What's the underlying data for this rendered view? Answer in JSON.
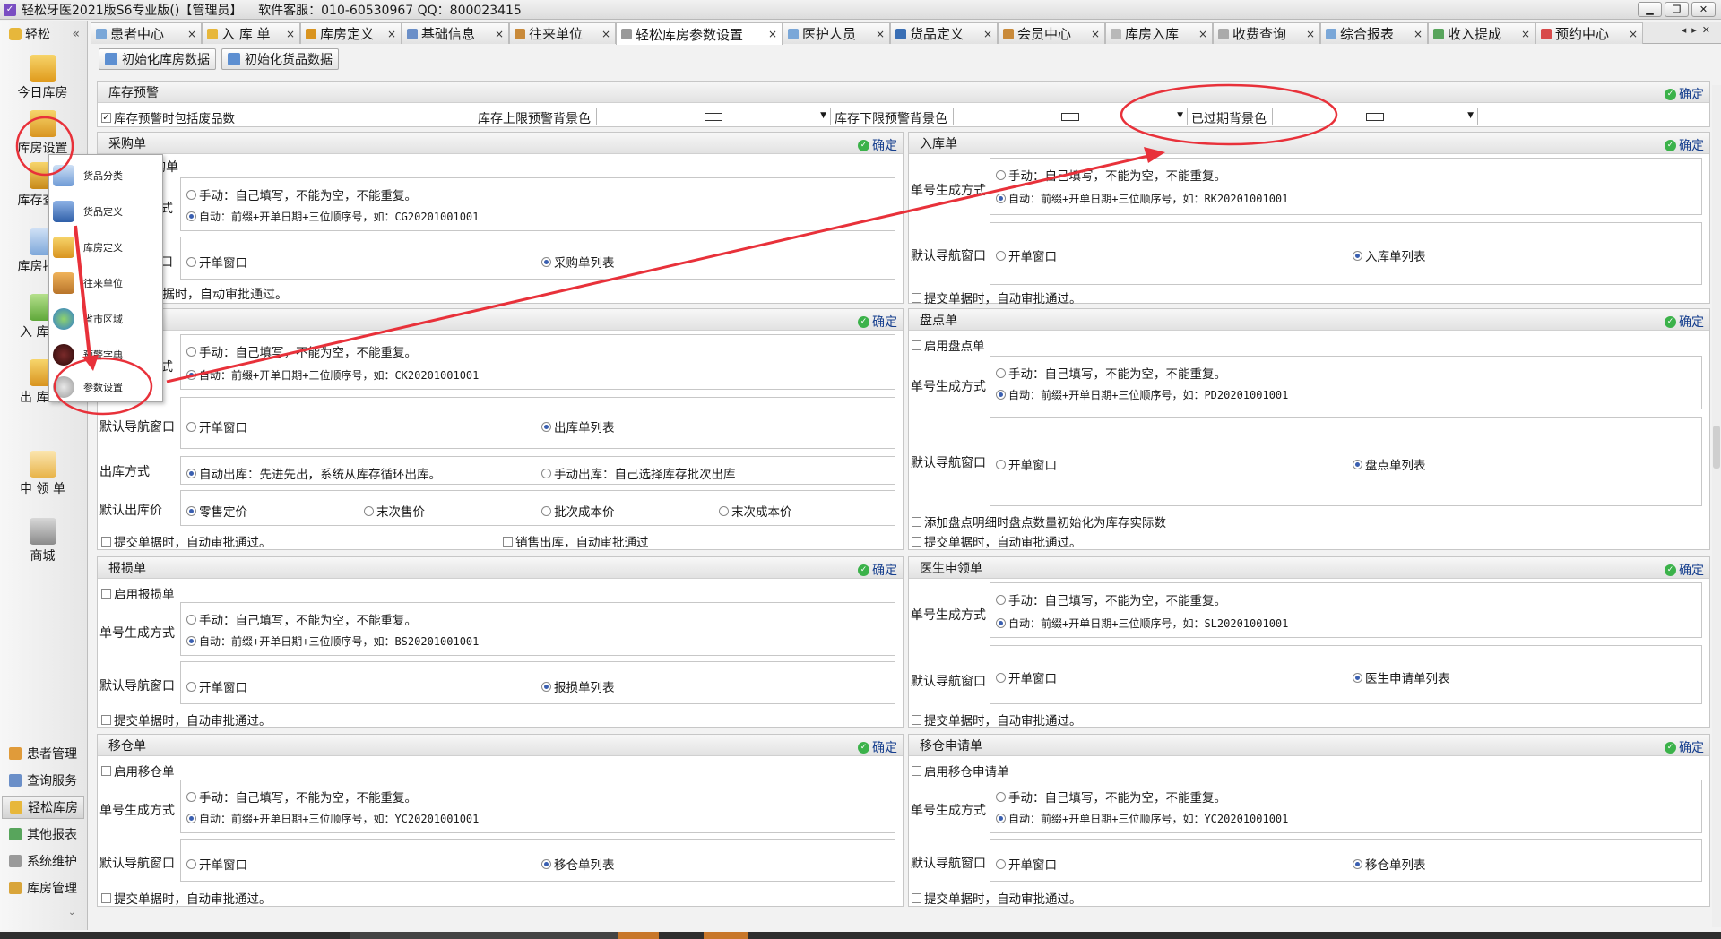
{
  "app": {
    "title": "轻松牙医2021版S6专业版()【管理员】    软件客服：010-60530967 QQ：800023415"
  },
  "nav": {
    "header": "轻松",
    "collapse": "«",
    "items": [
      "今日库房",
      "库房设置",
      "库存查询",
      "库房报表",
      "入 库 单",
      "出 库 单",
      "申 领 单",
      "商城"
    ],
    "bottom": [
      "患者管理",
      "查询服务",
      "轻松库房",
      "其他报表",
      "系统维护",
      "库房管理"
    ]
  },
  "tabs": [
    "患者中心",
    "入 库 单",
    "库房定义",
    "基础信息",
    "往来单位",
    "轻松库房参数设置",
    "医护人员",
    "货品定义",
    "会员中心",
    "库房入库",
    "收费查询",
    "综合报表",
    "收入提成",
    "预约中心"
  ],
  "toolbar": {
    "init_warehouse": "初始化库房数据",
    "init_goods": "初始化货品数据"
  },
  "common": {
    "ok": "确定",
    "manual": "手动：自己填写，不能为空，不能重复。",
    "number_mode": "单号生成方式",
    "nav_window": "默认导航窗口",
    "open_window": "开单窗口",
    "auto_approve": "提交单据时，自动审批通过。"
  },
  "warning": {
    "title": "库存预警",
    "include_waste": "库存预警时包括废品数",
    "upper_color": "库存上限预警背景色",
    "lower_color": "库存下限预警背景色",
    "expired_color": "已过期背景色"
  },
  "purchase": {
    "title": "采购单",
    "list": "采购单列表",
    "auto": "自动：前缀+开单日期+三位顺序号，如：CG20201001001"
  },
  "inbound": {
    "title": "入库单",
    "list": "入库单列表",
    "auto": "自动：前缀+开单日期+三位顺序号，如：RK20201001001"
  },
  "outbound": {
    "auto": "自动：前缀+开单日期+三位顺序号，如：CK20201001001",
    "list": "出库单列表",
    "method_label": "出库方式",
    "auto_out": "自动出库：先进先出，系统从库存循环出库。",
    "manual_out": "手动出库：自己选择库存批次出库",
    "price_label": "默认出库价",
    "price_options": [
      "零售定价",
      "末次售价",
      "批次成本价",
      "末次成本价"
    ],
    "sale_out": "销售出库，自动审批通过"
  },
  "stocktake": {
    "title": "盘点单",
    "enable": "启用盘点单",
    "auto": "自动：前缀+开单日期+三位顺序号，如：PD20201001001",
    "list": "盘点单列表",
    "init_actual": "添加盘点明细时盘点数量初始化为库存实际数"
  },
  "damage": {
    "title": "报损单",
    "enable": "启用报损单",
    "auto": "自动：前缀+开单日期+三位顺序号，如：BS20201001001",
    "list": "报损单列表"
  },
  "doctor_req": {
    "title": "医生申领单",
    "auto": "自动：前缀+开单日期+三位顺序号，如：SL20201001001",
    "list": "医生申请单列表"
  },
  "transfer": {
    "title": "移仓单",
    "enable": "启用移仓单",
    "auto": "自动：前缀+开单日期+三位顺序号，如：YC20201001001",
    "list": "移仓单列表"
  },
  "transfer_req": {
    "title": "移仓申请单",
    "enable": "启用移仓申请单",
    "auto": "自动：前缀+开单日期+三位顺序号，如：YC20201001001",
    "list": "移仓单列表"
  },
  "popup": [
    "货品分类",
    "货品定义",
    "库房定义",
    "往来单位",
    "省市区域",
    "预警字典",
    "参数设置"
  ],
  "overlay_partials": {
    "p_num": "购单",
    "p_mode": "式",
    "p_nav": "口",
    "p_sub": "据时，自动审批通过。",
    "o_mode": "式"
  },
  "colors": {
    "accent": "#163f8e",
    "annotation": "#e8313a",
    "ok_green": "#3bb24a"
  }
}
